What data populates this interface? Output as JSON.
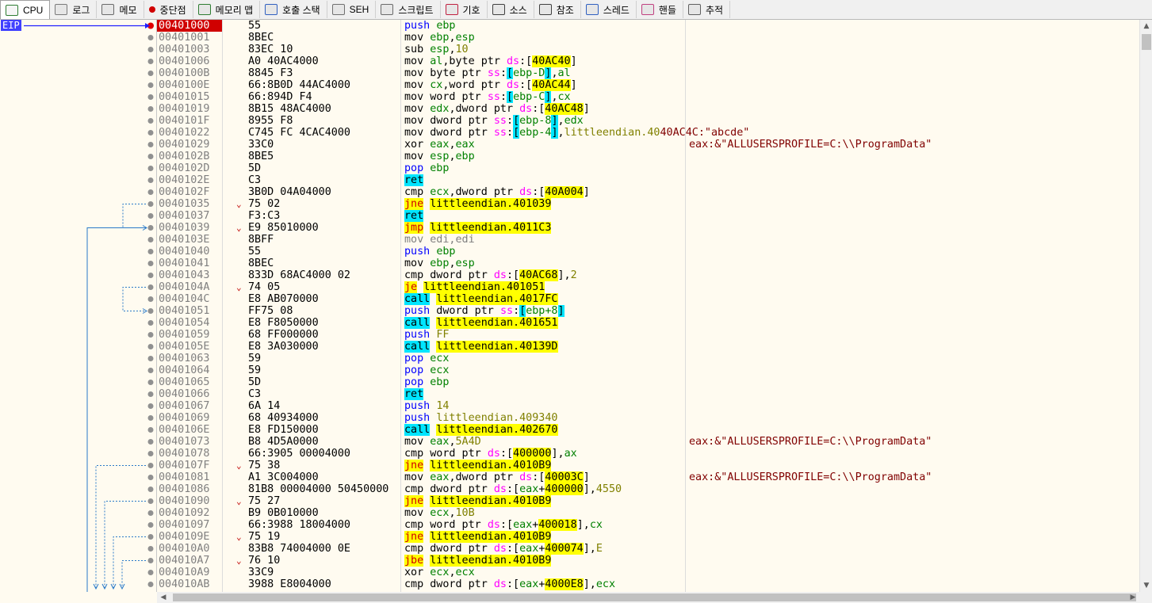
{
  "tabs": [
    {
      "id": "cpu",
      "label": "CPU",
      "icon": "cpu-icon",
      "active": true
    },
    {
      "id": "log",
      "label": "로그",
      "icon": "log-icon"
    },
    {
      "id": "memo",
      "label": "메모",
      "icon": "notes-icon"
    },
    {
      "id": "bp",
      "label": "중단점",
      "icon": "breakpoint-icon"
    },
    {
      "id": "memmap",
      "label": "메모리 맵",
      "icon": "memory-map-icon"
    },
    {
      "id": "callstack",
      "label": "호출 스택",
      "icon": "call-stack-icon"
    },
    {
      "id": "seh",
      "label": "SEH",
      "icon": "seh-icon"
    },
    {
      "id": "script",
      "label": "스크립트",
      "icon": "script-icon"
    },
    {
      "id": "symbols",
      "label": "기호",
      "icon": "symbols-icon"
    },
    {
      "id": "source",
      "label": "소스",
      "icon": "source-icon"
    },
    {
      "id": "refs",
      "label": "참조",
      "icon": "search-icon"
    },
    {
      "id": "threads",
      "label": "스레드",
      "icon": "threads-icon"
    },
    {
      "id": "handles",
      "label": "핸들",
      "icon": "handles-icon"
    },
    {
      "id": "trace",
      "label": "추적",
      "icon": "trace-icon"
    }
  ],
  "gutter": {
    "eip_label": "EIP"
  },
  "colors": {
    "eip_bg": "#d00000",
    "accent": "#4040ff",
    "jump_yellow": "#ffff00",
    "call_cyan": "#00e5ff"
  },
  "rows": [
    {
      "addr": "00401000",
      "bytes": "55",
      "instr": [
        [
          "k-push",
          "push"
        ],
        [
          "t-txt",
          " "
        ],
        [
          "t-reg",
          "ebp"
        ]
      ],
      "eip": true
    },
    {
      "addr": "00401001",
      "bytes": "8BEC",
      "instr": [
        [
          "k-mov",
          "mov"
        ],
        [
          "t-txt",
          " "
        ],
        [
          "t-reg",
          "ebp"
        ],
        [
          "t-txt",
          ","
        ],
        [
          "t-reg",
          "esp"
        ]
      ]
    },
    {
      "addr": "00401003",
      "bytes": "83EC 10",
      "instr": [
        [
          "k-sub",
          "sub"
        ],
        [
          "t-txt",
          " "
        ],
        [
          "t-reg",
          "esp"
        ],
        [
          "t-txt",
          ","
        ],
        [
          "t-num",
          "10"
        ]
      ]
    },
    {
      "addr": "00401006",
      "bytes": "A0 40AC4000",
      "instr": [
        [
          "k-mov",
          "mov"
        ],
        [
          "t-txt",
          " "
        ],
        [
          "t-reg",
          "al"
        ],
        [
          "t-txt",
          ",byte ptr "
        ],
        [
          "t-seg",
          "ds"
        ],
        [
          "t-txt",
          ":["
        ],
        [
          "t-mem",
          "40AC40"
        ],
        [
          "t-txt",
          "]"
        ]
      ]
    },
    {
      "addr": "0040100B",
      "bytes": "8845 F3",
      "instr": [
        [
          "k-mov",
          "mov"
        ],
        [
          "t-txt",
          " byte ptr "
        ],
        [
          "t-seg",
          "ss"
        ],
        [
          "t-txt",
          ":"
        ],
        [
          "t-stk",
          "["
        ],
        [
          "t-reg2",
          "ebp-D"
        ],
        [
          "t-stk",
          "]"
        ],
        [
          "t-txt",
          ","
        ],
        [
          "t-reg",
          "al"
        ]
      ]
    },
    {
      "addr": "0040100E",
      "bytes": "66:8B0D 44AC4000",
      "instr": [
        [
          "k-mov",
          "mov"
        ],
        [
          "t-txt",
          " "
        ],
        [
          "t-reg",
          "cx"
        ],
        [
          "t-txt",
          ",word ptr "
        ],
        [
          "t-seg",
          "ds"
        ],
        [
          "t-txt",
          ":["
        ],
        [
          "t-mem",
          "40AC44"
        ],
        [
          "t-txt",
          "]"
        ]
      ]
    },
    {
      "addr": "00401015",
      "bytes": "66:894D F4",
      "instr": [
        [
          "k-mov",
          "mov"
        ],
        [
          "t-txt",
          " word ptr "
        ],
        [
          "t-seg",
          "ss"
        ],
        [
          "t-txt",
          ":"
        ],
        [
          "t-stk",
          "["
        ],
        [
          "t-reg2",
          "ebp-C"
        ],
        [
          "t-stk",
          "]"
        ],
        [
          "t-txt",
          ","
        ],
        [
          "t-reg",
          "cx"
        ]
      ]
    },
    {
      "addr": "00401019",
      "bytes": "8B15 48AC4000",
      "instr": [
        [
          "k-mov",
          "mov"
        ],
        [
          "t-txt",
          " "
        ],
        [
          "t-reg",
          "edx"
        ],
        [
          "t-txt",
          ",dword ptr "
        ],
        [
          "t-seg",
          "ds"
        ],
        [
          "t-txt",
          ":["
        ],
        [
          "t-mem",
          "40AC48"
        ],
        [
          "t-txt",
          "]"
        ]
      ]
    },
    {
      "addr": "0040101F",
      "bytes": "8955 F8",
      "instr": [
        [
          "k-mov",
          "mov"
        ],
        [
          "t-txt",
          " dword ptr "
        ],
        [
          "t-seg",
          "ss"
        ],
        [
          "t-txt",
          ":"
        ],
        [
          "t-stk",
          "["
        ],
        [
          "t-reg2",
          "ebp-8"
        ],
        [
          "t-stk",
          "]"
        ],
        [
          "t-txt",
          ","
        ],
        [
          "t-reg",
          "edx"
        ]
      ]
    },
    {
      "addr": "00401022",
      "bytes": "C745 FC 4CAC4000",
      "instr": [
        [
          "k-mov",
          "mov"
        ],
        [
          "t-txt",
          " dword ptr "
        ],
        [
          "t-seg",
          "ss"
        ],
        [
          "t-txt",
          ":"
        ],
        [
          "t-stk",
          "["
        ],
        [
          "t-reg2",
          "ebp-4"
        ],
        [
          "t-stk",
          "]"
        ],
        [
          "t-txt",
          ","
        ],
        [
          "t-num",
          "littleendian.40"
        ],
        [
          "t-str",
          "40AC4C:\"abcde\""
        ]
      ]
    },
    {
      "addr": "00401029",
      "bytes": "33C0",
      "instr": [
        [
          "k-xor",
          "xor"
        ],
        [
          "t-txt",
          " "
        ],
        [
          "t-reg",
          "eax"
        ],
        [
          "t-txt",
          ","
        ],
        [
          "t-reg",
          "eax"
        ]
      ],
      "comment": "eax:&\"ALLUSERSPROFILE=C:\\\\ProgramData\""
    },
    {
      "addr": "0040102B",
      "bytes": "8BE5",
      "instr": [
        [
          "k-mov",
          "mov"
        ],
        [
          "t-txt",
          " "
        ],
        [
          "t-reg",
          "esp"
        ],
        [
          "t-txt",
          ","
        ],
        [
          "t-reg",
          "ebp"
        ]
      ]
    },
    {
      "addr": "0040102D",
      "bytes": "5D",
      "instr": [
        [
          "k-pop",
          "pop"
        ],
        [
          "t-txt",
          " "
        ],
        [
          "t-reg",
          "ebp"
        ]
      ]
    },
    {
      "addr": "0040102E",
      "bytes": "C3",
      "instr": [
        [
          "k-ret",
          "ret"
        ]
      ]
    },
    {
      "addr": "0040102F",
      "bytes": "3B0D 04A04000",
      "instr": [
        [
          "k-cmp",
          "cmp"
        ],
        [
          "t-txt",
          " "
        ],
        [
          "t-reg",
          "ecx"
        ],
        [
          "t-txt",
          ",dword ptr "
        ],
        [
          "t-seg",
          "ds"
        ],
        [
          "t-txt",
          ":["
        ],
        [
          "t-mem",
          "40A004"
        ],
        [
          "t-txt",
          "]"
        ]
      ]
    },
    {
      "addr": "00401035",
      "bytes": "75 02",
      "arrow": "⌄",
      "instr": [
        [
          "k-jcc",
          "jne"
        ],
        [
          "t-txt",
          " "
        ],
        [
          "t-dest",
          "littleendian.401039"
        ]
      ]
    },
    {
      "addr": "00401037",
      "bytes": "F3:C3",
      "instr": [
        [
          "k-ret",
          "ret"
        ]
      ]
    },
    {
      "addr": "00401039",
      "bytes": "E9 85010000",
      "arrow": "⌄",
      "instr": [
        [
          "k-jcc",
          "jmp"
        ],
        [
          "t-txt",
          " "
        ],
        [
          "t-dest",
          "littleendian.4011C3"
        ]
      ]
    },
    {
      "addr": "0040103E",
      "bytes": "8BFF",
      "instr": [
        [
          "k-nop",
          "mov edi,edi"
        ]
      ]
    },
    {
      "addr": "00401040",
      "bytes": "55",
      "instr": [
        [
          "k-push",
          "push"
        ],
        [
          "t-txt",
          " "
        ],
        [
          "t-reg",
          "ebp"
        ]
      ]
    },
    {
      "addr": "00401041",
      "bytes": "8BEC",
      "instr": [
        [
          "k-mov",
          "mov"
        ],
        [
          "t-txt",
          " "
        ],
        [
          "t-reg",
          "ebp"
        ],
        [
          "t-txt",
          ","
        ],
        [
          "t-reg",
          "esp"
        ]
      ]
    },
    {
      "addr": "00401043",
      "bytes": "833D 68AC4000 02",
      "instr": [
        [
          "k-cmp",
          "cmp"
        ],
        [
          "t-txt",
          " dword ptr "
        ],
        [
          "t-seg",
          "ds"
        ],
        [
          "t-txt",
          ":["
        ],
        [
          "t-mem",
          "40AC68"
        ],
        [
          "t-txt",
          "],"
        ],
        [
          "t-num",
          "2"
        ]
      ]
    },
    {
      "addr": "0040104A",
      "bytes": "74 05",
      "arrow": "⌄",
      "instr": [
        [
          "k-jcc",
          "je"
        ],
        [
          "t-txt",
          " "
        ],
        [
          "t-dest",
          "littleendian.401051"
        ]
      ]
    },
    {
      "addr": "0040104C",
      "bytes": "E8 AB070000",
      "instr": [
        [
          "k-call",
          "call"
        ],
        [
          "t-txt",
          " "
        ],
        [
          "t-dest",
          "littleendian.4017FC"
        ]
      ]
    },
    {
      "addr": "00401051",
      "bytes": "FF75 08",
      "instr": [
        [
          "k-push",
          "push"
        ],
        [
          "t-txt",
          " dword ptr "
        ],
        [
          "t-seg",
          "ss"
        ],
        [
          "t-txt",
          ":"
        ],
        [
          "t-stk",
          "["
        ],
        [
          "t-reg2",
          "ebp+8"
        ],
        [
          "t-stk",
          "]"
        ]
      ]
    },
    {
      "addr": "00401054",
      "bytes": "E8 F8050000",
      "instr": [
        [
          "k-call",
          "call"
        ],
        [
          "t-txt",
          " "
        ],
        [
          "t-dest",
          "littleendian.401651"
        ]
      ]
    },
    {
      "addr": "00401059",
      "bytes": "68 FF000000",
      "instr": [
        [
          "k-push",
          "push"
        ],
        [
          "t-txt",
          " "
        ],
        [
          "t-num",
          "FF"
        ]
      ]
    },
    {
      "addr": "0040105E",
      "bytes": "E8 3A030000",
      "instr": [
        [
          "k-call",
          "call"
        ],
        [
          "t-txt",
          " "
        ],
        [
          "t-dest",
          "littleendian.40139D"
        ]
      ]
    },
    {
      "addr": "00401063",
      "bytes": "59",
      "instr": [
        [
          "k-pop",
          "pop"
        ],
        [
          "t-txt",
          " "
        ],
        [
          "t-reg",
          "ecx"
        ]
      ]
    },
    {
      "addr": "00401064",
      "bytes": "59",
      "instr": [
        [
          "k-pop",
          "pop"
        ],
        [
          "t-txt",
          " "
        ],
        [
          "t-reg",
          "ecx"
        ]
      ]
    },
    {
      "addr": "00401065",
      "bytes": "5D",
      "instr": [
        [
          "k-pop",
          "pop"
        ],
        [
          "t-txt",
          " "
        ],
        [
          "t-reg",
          "ebp"
        ]
      ]
    },
    {
      "addr": "00401066",
      "bytes": "C3",
      "instr": [
        [
          "k-ret",
          "ret"
        ]
      ]
    },
    {
      "addr": "00401067",
      "bytes": "6A 14",
      "instr": [
        [
          "k-push",
          "push"
        ],
        [
          "t-txt",
          " "
        ],
        [
          "t-num",
          "14"
        ]
      ]
    },
    {
      "addr": "00401069",
      "bytes": "68 40934000",
      "instr": [
        [
          "k-push",
          "push"
        ],
        [
          "t-txt",
          " "
        ],
        [
          "t-num",
          "littleendian.409340"
        ]
      ]
    },
    {
      "addr": "0040106E",
      "bytes": "E8 FD150000",
      "instr": [
        [
          "k-call",
          "call"
        ],
        [
          "t-txt",
          " "
        ],
        [
          "t-dest",
          "littleendian.402670"
        ]
      ]
    },
    {
      "addr": "00401073",
      "bytes": "B8 4D5A0000",
      "instr": [
        [
          "k-mov",
          "mov"
        ],
        [
          "t-txt",
          " "
        ],
        [
          "t-reg",
          "eax"
        ],
        [
          "t-txt",
          ","
        ],
        [
          "t-num",
          "5A4D"
        ]
      ],
      "comment": "eax:&\"ALLUSERSPROFILE=C:\\\\ProgramData\""
    },
    {
      "addr": "00401078",
      "bytes": "66:3905 00004000",
      "instr": [
        [
          "k-cmp",
          "cmp"
        ],
        [
          "t-txt",
          " word ptr "
        ],
        [
          "t-seg",
          "ds"
        ],
        [
          "t-txt",
          ":["
        ],
        [
          "t-mem",
          "400000"
        ],
        [
          "t-txt",
          "],"
        ],
        [
          "t-reg",
          "ax"
        ]
      ]
    },
    {
      "addr": "0040107F",
      "bytes": "75 38",
      "arrow": "⌄",
      "instr": [
        [
          "k-jcc",
          "jne"
        ],
        [
          "t-txt",
          " "
        ],
        [
          "t-dest",
          "littleendian.4010B9"
        ]
      ]
    },
    {
      "addr": "00401081",
      "bytes": "A1 3C004000",
      "instr": [
        [
          "k-mov",
          "mov"
        ],
        [
          "t-txt",
          " "
        ],
        [
          "t-reg",
          "eax"
        ],
        [
          "t-txt",
          ",dword ptr "
        ],
        [
          "t-seg",
          "ds"
        ],
        [
          "t-txt",
          ":["
        ],
        [
          "t-mem",
          "40003C"
        ],
        [
          "t-txt",
          "]"
        ]
      ],
      "comment": "eax:&\"ALLUSERSPROFILE=C:\\\\ProgramData\""
    },
    {
      "addr": "00401086",
      "bytes": "81B8 00004000 50450000",
      "instr": [
        [
          "k-cmp",
          "cmp"
        ],
        [
          "t-txt",
          " dword ptr "
        ],
        [
          "t-seg",
          "ds"
        ],
        [
          "t-txt",
          ":["
        ],
        [
          "t-reg",
          "eax"
        ],
        [
          "t-txt",
          "+"
        ],
        [
          "t-mem",
          "400000"
        ],
        [
          "t-txt",
          "],"
        ],
        [
          "t-num",
          "4550"
        ]
      ]
    },
    {
      "addr": "00401090",
      "bytes": "75 27",
      "arrow": "⌄",
      "instr": [
        [
          "k-jcc",
          "jne"
        ],
        [
          "t-txt",
          " "
        ],
        [
          "t-dest",
          "littleendian.4010B9"
        ]
      ]
    },
    {
      "addr": "00401092",
      "bytes": "B9 0B010000",
      "instr": [
        [
          "k-mov",
          "mov"
        ],
        [
          "t-txt",
          " "
        ],
        [
          "t-reg",
          "ecx"
        ],
        [
          "t-txt",
          ","
        ],
        [
          "t-num",
          "10B"
        ]
      ]
    },
    {
      "addr": "00401097",
      "bytes": "66:3988 18004000",
      "instr": [
        [
          "k-cmp",
          "cmp"
        ],
        [
          "t-txt",
          " word ptr "
        ],
        [
          "t-seg",
          "ds"
        ],
        [
          "t-txt",
          ":["
        ],
        [
          "t-reg",
          "eax"
        ],
        [
          "t-txt",
          "+"
        ],
        [
          "t-mem",
          "400018"
        ],
        [
          "t-txt",
          "],"
        ],
        [
          "t-reg",
          "cx"
        ]
      ]
    },
    {
      "addr": "0040109E",
      "bytes": "75 19",
      "arrow": "⌄",
      "instr": [
        [
          "k-jcc",
          "jne"
        ],
        [
          "t-txt",
          " "
        ],
        [
          "t-dest",
          "littleendian.4010B9"
        ]
      ]
    },
    {
      "addr": "004010A0",
      "bytes": "83B8 74004000 0E",
      "instr": [
        [
          "k-cmp",
          "cmp"
        ],
        [
          "t-txt",
          " dword ptr "
        ],
        [
          "t-seg",
          "ds"
        ],
        [
          "t-txt",
          ":["
        ],
        [
          "t-reg",
          "eax"
        ],
        [
          "t-txt",
          "+"
        ],
        [
          "t-mem",
          "400074"
        ],
        [
          "t-txt",
          "],"
        ],
        [
          "t-num",
          "E"
        ]
      ]
    },
    {
      "addr": "004010A7",
      "bytes": "76 10",
      "arrow": "⌄",
      "instr": [
        [
          "k-jcc",
          "jbe"
        ],
        [
          "t-txt",
          " "
        ],
        [
          "t-dest",
          "littleendian.4010B9"
        ]
      ]
    },
    {
      "addr": "004010A9",
      "bytes": "33C9",
      "instr": [
        [
          "k-xor",
          "xor"
        ],
        [
          "t-txt",
          " "
        ],
        [
          "t-reg",
          "ecx"
        ],
        [
          "t-txt",
          ","
        ],
        [
          "t-reg",
          "ecx"
        ]
      ]
    },
    {
      "addr": "004010AB",
      "bytes": "3988 E8004000",
      "instr": [
        [
          "k-cmp",
          "cmp"
        ],
        [
          "t-txt",
          " dword ptr "
        ],
        [
          "t-seg",
          "ds"
        ],
        [
          "t-txt",
          ":["
        ],
        [
          "t-reg",
          "eax"
        ],
        [
          "t-txt",
          "+"
        ],
        [
          "t-mem",
          "4000E8"
        ],
        [
          "t-txt",
          "],"
        ],
        [
          "t-reg",
          "ecx"
        ]
      ]
    }
  ]
}
